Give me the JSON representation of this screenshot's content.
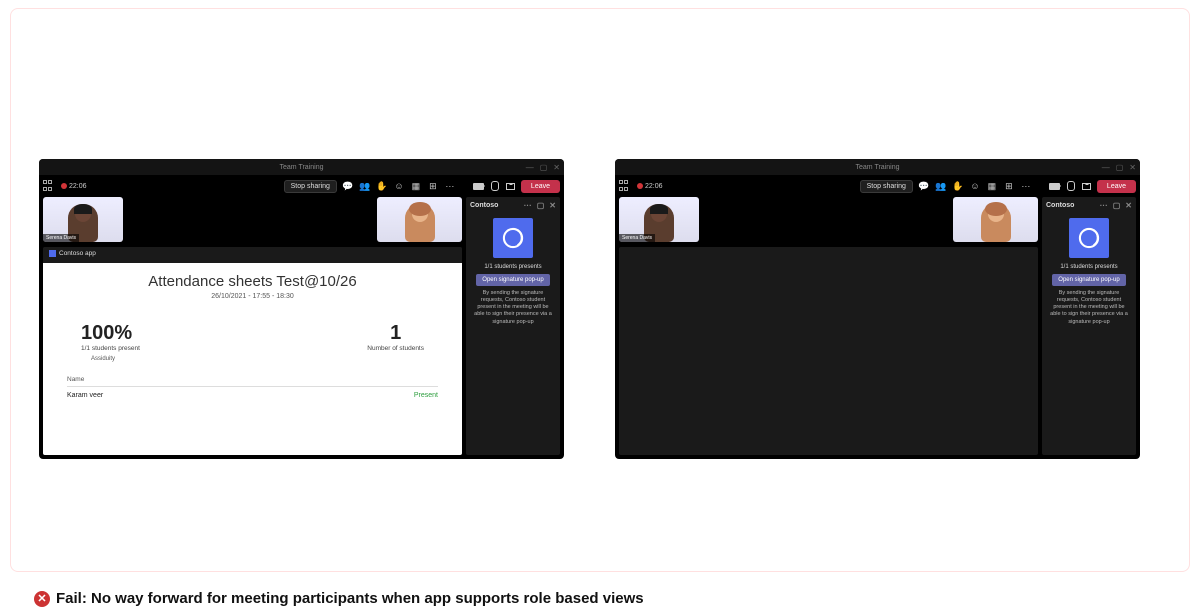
{
  "titlebar": {
    "title": "Team Training"
  },
  "toolbar": {
    "recTime": "22:06",
    "stopShare": "Stop sharing",
    "ellipsis": "···",
    "leave": "Leave"
  },
  "participants": [
    {
      "name": "Serena Davis"
    },
    {
      "name": ""
    }
  ],
  "sidepanel": {
    "title": "Contoso",
    "studentsLine": "1/1 students presents",
    "button": "Open signature pop-up",
    "description": "By sending the signature requests, Contoso student present in the meeting will be able to sign their presence via a signature pop-up"
  },
  "appTab": {
    "label": "Contoso app"
  },
  "sheet": {
    "title": "Attendance sheets Test@10/26",
    "subtitle": "26/10/2021 - 17:55 - 18:30",
    "stat1Big": "100%",
    "stat1Label": "1/1 students present",
    "stat1Sub": "Assiduity",
    "stat2Big": "1",
    "stat2Label": "Number of students",
    "nameHeader": "Name",
    "rows": [
      {
        "name": "Karam veer",
        "status": "Present"
      }
    ]
  },
  "caption": {
    "text": "Fail: No way forward for meeting participants when app supports role based views"
  }
}
